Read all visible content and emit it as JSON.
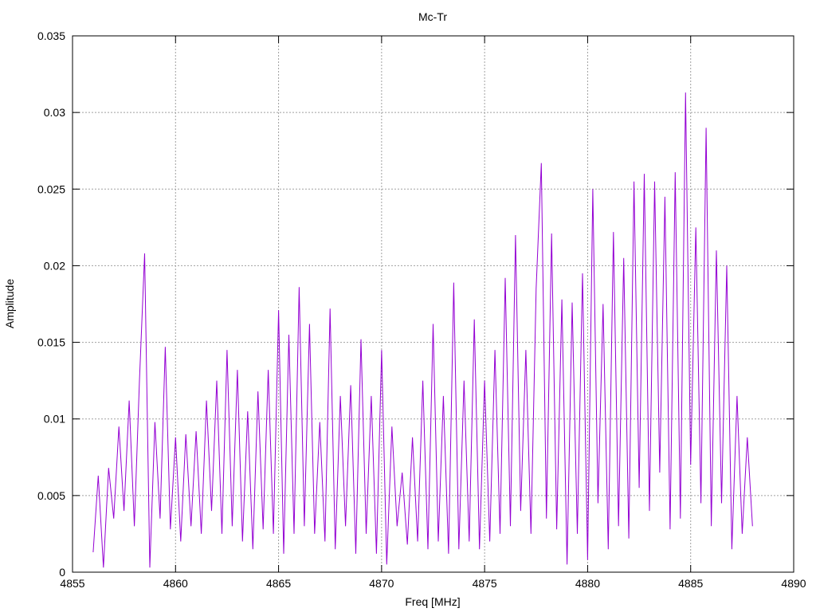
{
  "chart_data": {
    "type": "line",
    "title": "Mc-Tr",
    "xlabel": "Freq [MHz]",
    "ylabel": "Amplitude",
    "xlim": [
      4855,
      4890
    ],
    "ylim": [
      0,
      0.035
    ],
    "xticks": [
      4855,
      4860,
      4865,
      4870,
      4875,
      4880,
      4885,
      4890
    ],
    "xtick_labels": [
      "4855",
      "4860",
      "4865",
      "4870",
      "4875",
      "4880",
      "4885",
      "4890"
    ],
    "yticks": [
      0,
      0.005,
      0.01,
      0.015,
      0.02,
      0.025,
      0.03,
      0.035
    ],
    "ytick_labels": [
      "0",
      "0.005",
      "0.01",
      "0.015",
      "0.02",
      "0.025",
      "0.03",
      "0.035"
    ],
    "grid": true,
    "series_color": "#9400d3",
    "x_start": 4856,
    "x_step": 0.25,
    "series": [
      {
        "name": "Mc-Tr",
        "values": [
          0.0013,
          0.0063,
          0.0003,
          0.0068,
          0.0035,
          0.0095,
          0.004,
          0.0112,
          0.003,
          0.0125,
          0.0208,
          0.0003,
          0.0098,
          0.0035,
          0.0147,
          0.0028,
          0.0088,
          0.002,
          0.009,
          0.003,
          0.0092,
          0.0025,
          0.0112,
          0.004,
          0.0125,
          0.0025,
          0.0145,
          0.003,
          0.0132,
          0.002,
          0.0105,
          0.0015,
          0.0118,
          0.0028,
          0.0132,
          0.0025,
          0.0171,
          0.0012,
          0.0155,
          0.0025,
          0.0186,
          0.003,
          0.0162,
          0.0025,
          0.0098,
          0.002,
          0.0172,
          0.0015,
          0.0115,
          0.003,
          0.0122,
          0.0012,
          0.0152,
          0.0025,
          0.0115,
          0.0012,
          0.0145,
          0.0005,
          0.0095,
          0.003,
          0.0065,
          0.0018,
          0.0088,
          0.002,
          0.0125,
          0.0015,
          0.0162,
          0.002,
          0.0115,
          0.0012,
          0.0189,
          0.0015,
          0.0125,
          0.002,
          0.0165,
          0.0015,
          0.0125,
          0.002,
          0.0145,
          0.0025,
          0.0192,
          0.003,
          0.022,
          0.004,
          0.0145,
          0.0025,
          0.0185,
          0.0267,
          0.0035,
          0.0221,
          0.0028,
          0.0178,
          0.0005,
          0.0176,
          0.0025,
          0.0195,
          0.0008,
          0.025,
          0.0045,
          0.0175,
          0.0015,
          0.0222,
          0.003,
          0.0205,
          0.0022,
          0.0255,
          0.0055,
          0.026,
          0.004,
          0.0255,
          0.0065,
          0.0245,
          0.0028,
          0.0261,
          0.0035,
          0.0313,
          0.007,
          0.0225,
          0.0045,
          0.029,
          0.003,
          0.021,
          0.0045,
          0.02,
          0.0015,
          0.0115,
          0.0025,
          0.0088,
          0.003
        ]
      }
    ]
  }
}
